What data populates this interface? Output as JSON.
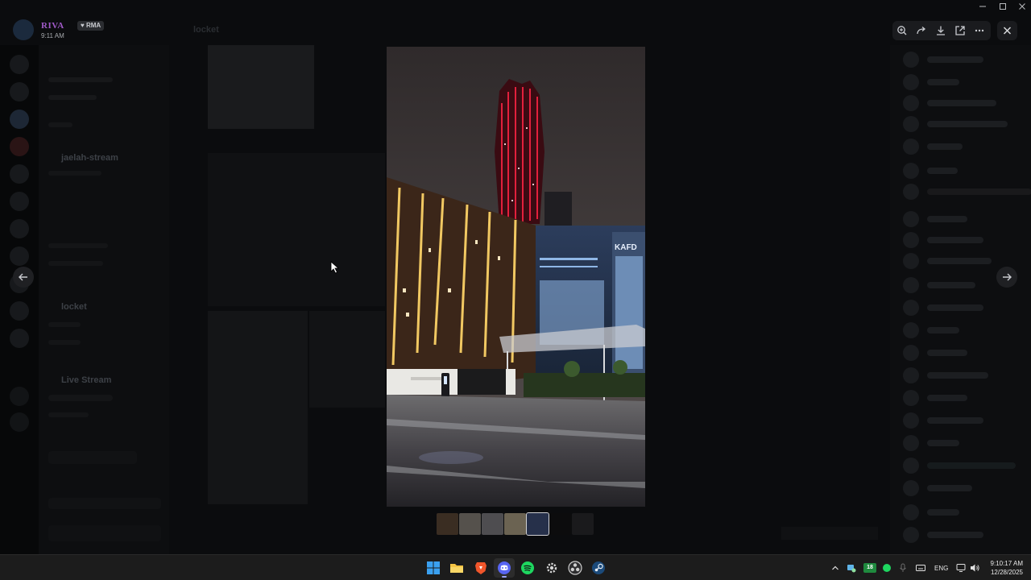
{
  "window": {
    "title": ""
  },
  "user": {
    "name": "RIVA",
    "tag": "RMA",
    "time": "9:11 AM"
  },
  "channel": {
    "header": "locket"
  },
  "sidebar": {
    "category_stream": "jaelah-stream",
    "channel_locket": "locket",
    "voice_label": "Live Stream"
  },
  "viewer": {
    "toolbar_icons": [
      "zoom-in-icon",
      "forward-icon",
      "download-icon",
      "open-external-icon",
      "more-icon"
    ],
    "close_icon": "close-icon",
    "thumbnails": 7,
    "active_thumbnail": 5
  },
  "taskbar": {
    "icons": [
      "windows-start-icon",
      "file-explorer-icon",
      "brave-browser-icon",
      "discord-icon",
      "spotify-icon",
      "settings-icon",
      "obs-icon",
      "steam-icon"
    ],
    "language": "ENG",
    "battery_badge": "18",
    "time": "9:10:17 AM",
    "date": "12/28/2025"
  },
  "colors": {
    "accent_discord": "#5865f2",
    "spotify": "#1ed760",
    "user_name": "#a05ac8"
  }
}
